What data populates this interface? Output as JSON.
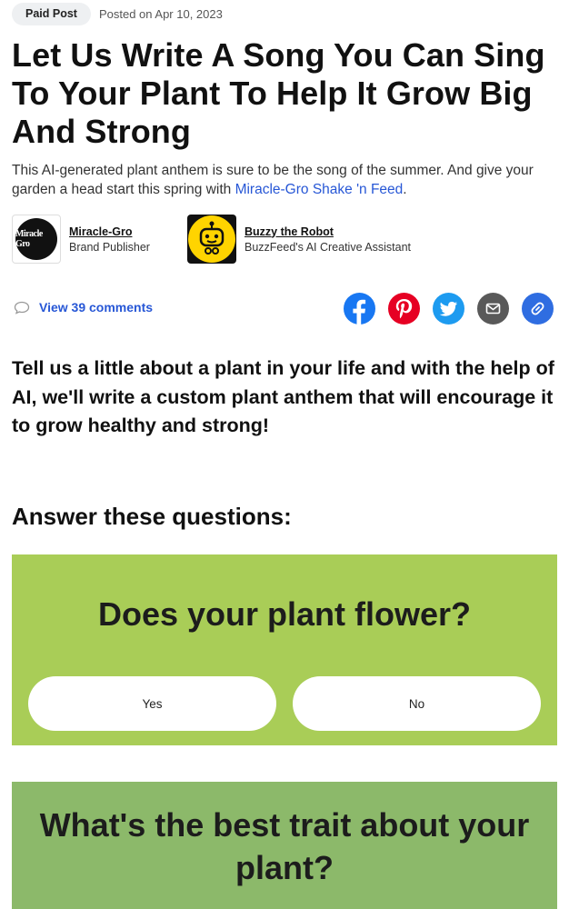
{
  "meta": {
    "badge": "Paid Post",
    "posted": "Posted on Apr 10, 2023"
  },
  "headline": "Let Us Write A Song You Can Sing To Your Plant To Help It Grow Big And Strong",
  "dek": {
    "text": "This AI-generated plant anthem is sure to be the song of the summer. And give your garden a head start this spring with ",
    "link": "Miracle-Gro Shake 'n Feed",
    "end": "."
  },
  "bylines": [
    {
      "name": "Miracle-Gro",
      "role": "Brand Publisher",
      "logo_text": "Miracle Gro",
      "icon": "miracle-gro-logo"
    },
    {
      "name": "Buzzy the Robot",
      "role": "BuzzFeed's AI Creative Assistant",
      "icon": "robot-icon"
    }
  ],
  "comments": {
    "label": "View 39 comments",
    "icon": "speech-bubble-icon"
  },
  "share": [
    {
      "icon": "facebook-icon",
      "color": "#1877f2"
    },
    {
      "icon": "pinterest-icon",
      "color": "#e60023"
    },
    {
      "icon": "twitter-icon",
      "color": "#1d9bf0"
    },
    {
      "icon": "email-icon",
      "color": "#595959"
    },
    {
      "icon": "link-icon",
      "color": "#2f6de1"
    }
  ],
  "intro": "Tell us a little about a plant in your life and with the help of AI, we'll write a custom plant anthem that will encourage it to grow healthy and strong!",
  "answer_heading": "Answer these questions:",
  "questions": [
    {
      "title": "Does your plant flower?",
      "options": [
        "Yes",
        "No"
      ],
      "bg": "#a9cd57"
    },
    {
      "title": "What's the best trait about your plant?",
      "bg": "#8cb96a"
    }
  ]
}
